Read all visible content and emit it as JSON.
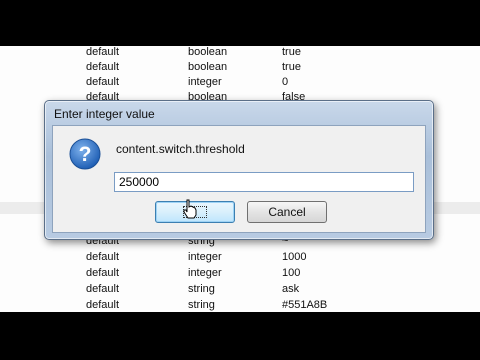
{
  "background_rows_top": [
    {
      "status": "default",
      "type": "boolean",
      "value": "true"
    },
    {
      "status": "default",
      "type": "boolean",
      "value": "true"
    },
    {
      "status": "default",
      "type": "integer",
      "value": "0"
    },
    {
      "status": "default",
      "type": "boolean",
      "value": "false"
    }
  ],
  "background_rows_bottom": [
    {
      "status": "default",
      "type": "string",
      "value": "~"
    },
    {
      "status": "default",
      "type": "integer",
      "value": "1000"
    },
    {
      "status": "default",
      "type": "integer",
      "value": "100"
    },
    {
      "status": "default",
      "type": "string",
      "value": "ask"
    },
    {
      "status": "default",
      "type": "string",
      "value": "#551A8B"
    }
  ],
  "dialog": {
    "title": "Enter integer value",
    "prompt": "content.switch.threshold",
    "input_value": "250000",
    "ok_label": "",
    "cancel_label": "Cancel"
  },
  "icons": {
    "dialog_icon": "question-icon",
    "pointer": "mouse-cursor-icon"
  },
  "colors": {
    "question_icon_blue": "#2f6fc3",
    "focus_border": "#3c7fb1"
  }
}
